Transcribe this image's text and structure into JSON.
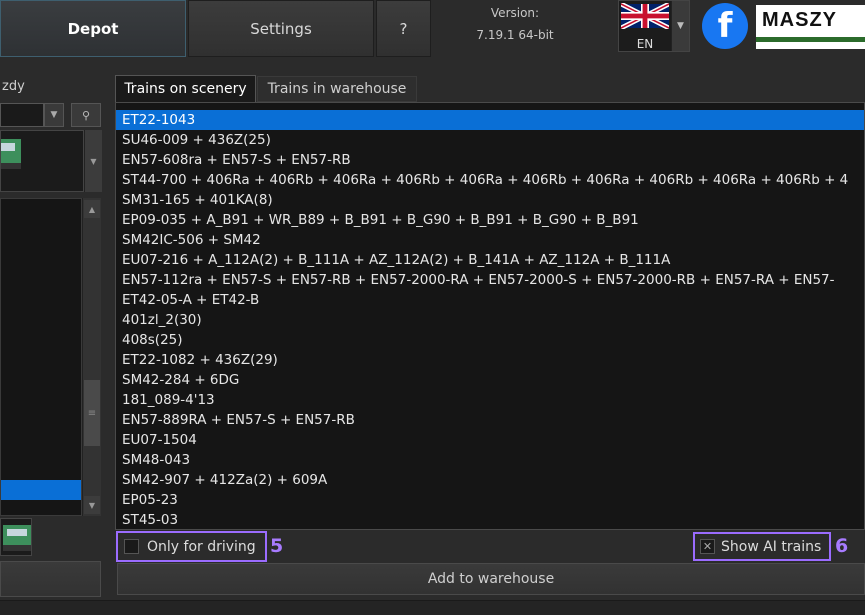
{
  "toolbar": {
    "depot_label": "Depot",
    "settings_label": "Settings",
    "help_label": "?"
  },
  "version": {
    "label": "Version:",
    "value": "7.19.1 64-bit"
  },
  "language": {
    "code": "EN",
    "flag_icon": "uk-flag-icon"
  },
  "social": {
    "facebook_glyph": "f"
  },
  "logo": {
    "text": "MASZY"
  },
  "left_panel": {
    "label": "zdy",
    "pin_glyph": "⚲"
  },
  "tabs": [
    {
      "label": "Trains on scenery",
      "active": true
    },
    {
      "label": "Trains in warehouse",
      "active": false
    }
  ],
  "trains": [
    "ET22-1043",
    "SU46-009 + 436Z(25)",
    "EN57-608ra + EN57-S + EN57-RB",
    "ST44-700 + 406Ra + 406Rb + 406Ra + 406Rb + 406Ra + 406Rb + 406Ra + 406Rb + 406Ra + 406Rb + 4",
    "SM31-165 + 401KA(8)",
    "EP09-035 + A_B91 + WR_B89 + B_B91 + B_G90 + B_B91 + B_G90 + B_B91",
    "SM42IC-506 + SM42",
    "EU07-216 + A_112A(2) + B_111A + AZ_112A(2) + B_141A + AZ_112A + B_111A",
    "EN57-112ra + EN57-S + EN57-RB + EN57-2000-RA + EN57-2000-S + EN57-2000-RB + EN57-RA + EN57-",
    "ET42-05-A + ET42-B",
    "401zl_2(30)",
    "408s(25)",
    "ET22-1082 + 436Z(29)",
    "SM42-284 + 6DG",
    "181_089-4'13",
    "EN57-889RA + EN57-S + EN57-RB",
    "EU07-1504",
    "SM48-043",
    "SM42-907 + 412Za(2) + 609A",
    "EP05-23",
    "ST45-03"
  ],
  "options": {
    "only_for_driving_label": "Only for driving",
    "only_for_driving_checked": false,
    "only_for_driving_marker": "5",
    "show_ai_label": "Show AI trains",
    "show_ai_checked": true,
    "show_ai_mark": "✕",
    "show_ai_marker": "6"
  },
  "add_to_warehouse_label": "Add to warehouse",
  "colors": {
    "selection": "#0a6fd6",
    "highlight": "#9b6cff",
    "facebook": "#1877f2"
  }
}
